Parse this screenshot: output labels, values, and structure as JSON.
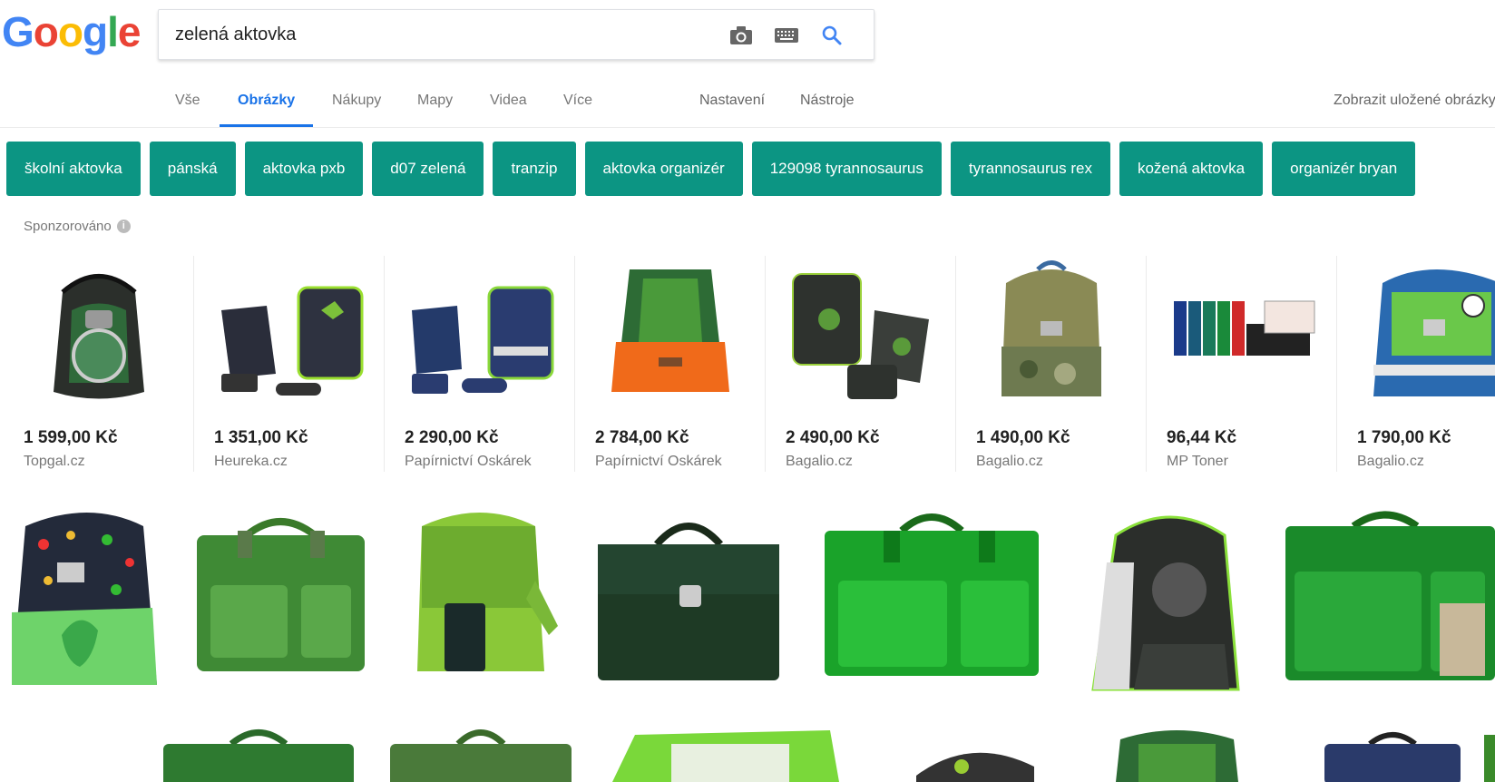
{
  "logo": {
    "text": [
      "G",
      "o",
      "o",
      "g",
      "l",
      "e"
    ],
    "colors": [
      "#4285f4",
      "#ea4335",
      "#fbbc05",
      "#4285f4",
      "#34a853",
      "#ea4335"
    ]
  },
  "search": {
    "value": "zelená aktovka"
  },
  "icons": {
    "camera": "camera-icon",
    "keyboard": "keyboard-icon",
    "search": "search-icon"
  },
  "tabs": [
    {
      "label": "Vše"
    },
    {
      "label": "Obrázky"
    },
    {
      "label": "Nákupy"
    },
    {
      "label": "Mapy"
    },
    {
      "label": "Videa"
    },
    {
      "label": "Více"
    }
  ],
  "tools": {
    "settings": "Nastavení",
    "tools": "Nástroje",
    "saved": "Zobrazit uložené obrázky"
  },
  "chips": [
    "školní aktovka",
    "pánská",
    "aktovka pxb",
    "d07 zelená",
    "tranzip",
    "aktovka organizér",
    "129098 tyrannosaurus",
    "tyrannosaurus rex",
    "kožená aktovka",
    "organizér bryan"
  ],
  "sponsored": {
    "label": "Sponzorováno",
    "info": "i"
  },
  "products": [
    {
      "price": "1 599,00 Kč",
      "store": "Topgal.cz"
    },
    {
      "price": "1 351,00 Kč",
      "store": "Heureka.cz"
    },
    {
      "price": "2 290,00 Kč",
      "store": "Papírnictví Oskárek"
    },
    {
      "price": "2 784,00 Kč",
      "store": "Papírnictví Oskárek"
    },
    {
      "price": "2 490,00 Kč",
      "store": "Bagalio.cz"
    },
    {
      "price": "1 490,00 Kč",
      "store": "Bagalio.cz"
    },
    {
      "price": "96,44 Kč",
      "store": "MP Toner"
    },
    {
      "price": "1 790,00 Kč",
      "store": "Bagalio.cz"
    }
  ],
  "colors": {
    "accent": "#1a73e8",
    "chip": "#0c9583",
    "muted": "#777777"
  }
}
